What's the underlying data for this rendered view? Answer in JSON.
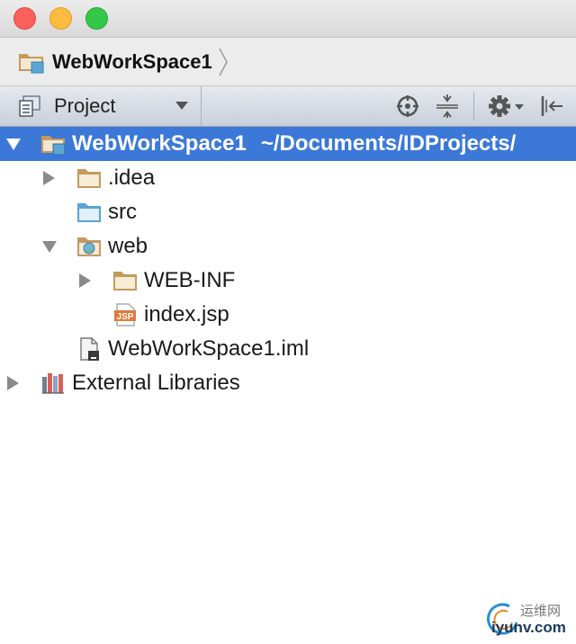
{
  "window": {
    "controls": [
      "close",
      "minimize",
      "zoom"
    ]
  },
  "breadcrumb": {
    "label": "WebWorkSpace1",
    "icon": "module-folder-icon"
  },
  "tool_window": {
    "view_label": "Project",
    "actions": [
      "locate-icon",
      "collapse-all-icon",
      "gear-icon",
      "hide-icon"
    ]
  },
  "tree": {
    "root": {
      "label": "WebWorkSpace1",
      "path": "~/Documents/IDProjects/",
      "expanded": true,
      "selected": true
    },
    "idea": {
      "label": ".idea",
      "expanded": false
    },
    "src": {
      "label": "src"
    },
    "web": {
      "label": "web",
      "expanded": true
    },
    "webinf": {
      "label": "WEB-INF",
      "expanded": false
    },
    "indexjsp": {
      "label": "index.jsp",
      "badge": "JSP"
    },
    "iml": {
      "label": "WebWorkSpace1.iml"
    },
    "external": {
      "label": "External Libraries",
      "expanded": false
    }
  },
  "watermark": {
    "cn": "运维网",
    "url": "iyunv.com"
  },
  "colors": {
    "selection": "#3b78d8",
    "folder": "#c49a5e",
    "source_folder": "#5aa4d6",
    "jsp": "#e07a3c"
  }
}
